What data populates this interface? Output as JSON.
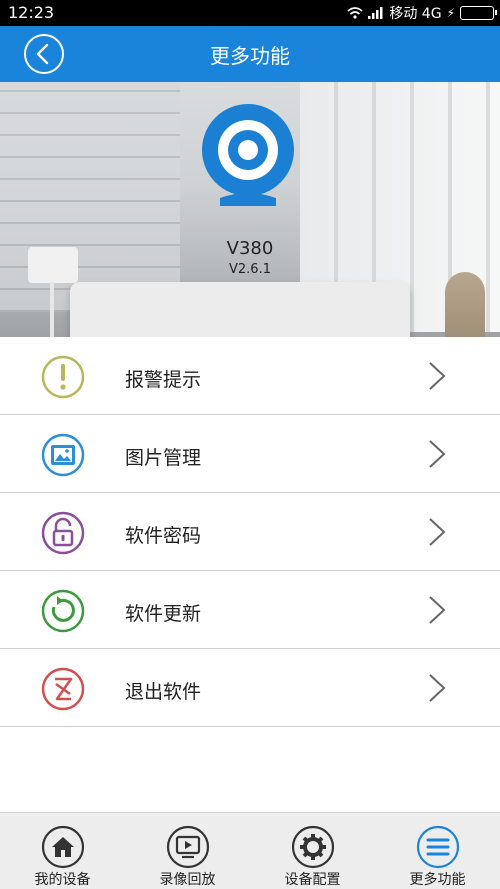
{
  "status_bar": {
    "time": "12:23",
    "carrier": "移动 4G"
  },
  "header": {
    "title": "更多功能",
    "back_icon": "chevron-left-circle-icon"
  },
  "banner": {
    "app_name": "V380",
    "version": "V2.6.1"
  },
  "menu": {
    "items": [
      {
        "label": "报警提示",
        "icon": "alert-icon",
        "color": "#b8b85a"
      },
      {
        "label": "图片管理",
        "icon": "image-icon",
        "color": "#2a8fd6"
      },
      {
        "label": "软件密码",
        "icon": "lock-icon",
        "color": "#8a4e9a"
      },
      {
        "label": "软件更新",
        "icon": "refresh-icon",
        "color": "#3c9a3c"
      },
      {
        "label": "退出软件",
        "icon": "exit-icon",
        "color": "#d24f4f"
      }
    ]
  },
  "tabs": [
    {
      "label": "我的设备",
      "icon": "home-icon",
      "active": false
    },
    {
      "label": "录像回放",
      "icon": "playback-icon",
      "active": false
    },
    {
      "label": "设备配置",
      "icon": "gear-icon",
      "active": false
    },
    {
      "label": "更多功能",
      "icon": "menu-icon",
      "active": true
    }
  ],
  "colors": {
    "primary": "#1a83da",
    "tab_active": "#1a83da",
    "tab_inactive": "#333333"
  }
}
